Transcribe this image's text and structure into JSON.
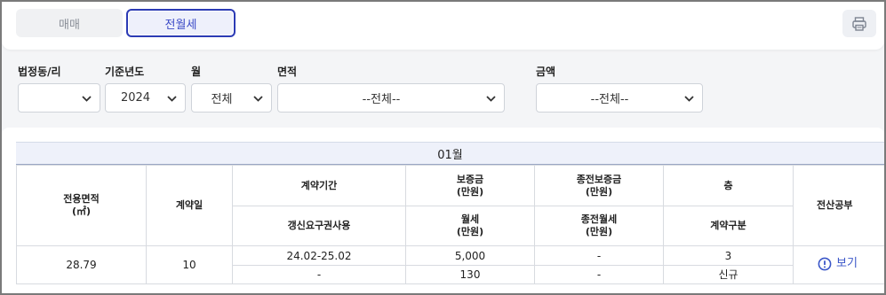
{
  "tabs": [
    {
      "label": "매매",
      "active": false
    },
    {
      "label": "전월세",
      "active": true
    }
  ],
  "toolbar": {
    "print_icon": "printer-icon"
  },
  "filters": {
    "district": {
      "label": "법정동/리",
      "value": ""
    },
    "year": {
      "label": "기준년도",
      "value": "2024"
    },
    "month": {
      "label": "월",
      "value": "전체"
    },
    "area": {
      "label": "면적",
      "value": "--전체--"
    },
    "amount": {
      "label": "금액",
      "value": "--전체--"
    }
  },
  "table": {
    "month_title": "01월",
    "headers": {
      "area": "전용면적\n(㎡)",
      "contract_day": "계약일",
      "contract_period": "계약기간",
      "deposit": "보증금\n(만원)",
      "prev_deposit": "종전보증금\n(만원)",
      "floor": "층",
      "registry": "전산공부",
      "renewal_right": "갱신요구권사용",
      "monthly_rent": "월세\n(만원)",
      "prev_monthly_rent": "종전월세\n(만원)",
      "contract_type": "계약구분"
    },
    "rows": [
      {
        "area": "28.79",
        "contract_day": "10",
        "contract_period": "24.02-25.02",
        "deposit": "5,000",
        "prev_deposit": "-",
        "floor": "3",
        "renewal_right": "-",
        "monthly_rent": "130",
        "prev_monthly_rent": "-",
        "contract_type": "신규",
        "registry_link": "보기"
      }
    ]
  },
  "colors": {
    "accent": "#2c3bb5",
    "link": "#3a56c8",
    "header_bg": "#eef1fa"
  }
}
